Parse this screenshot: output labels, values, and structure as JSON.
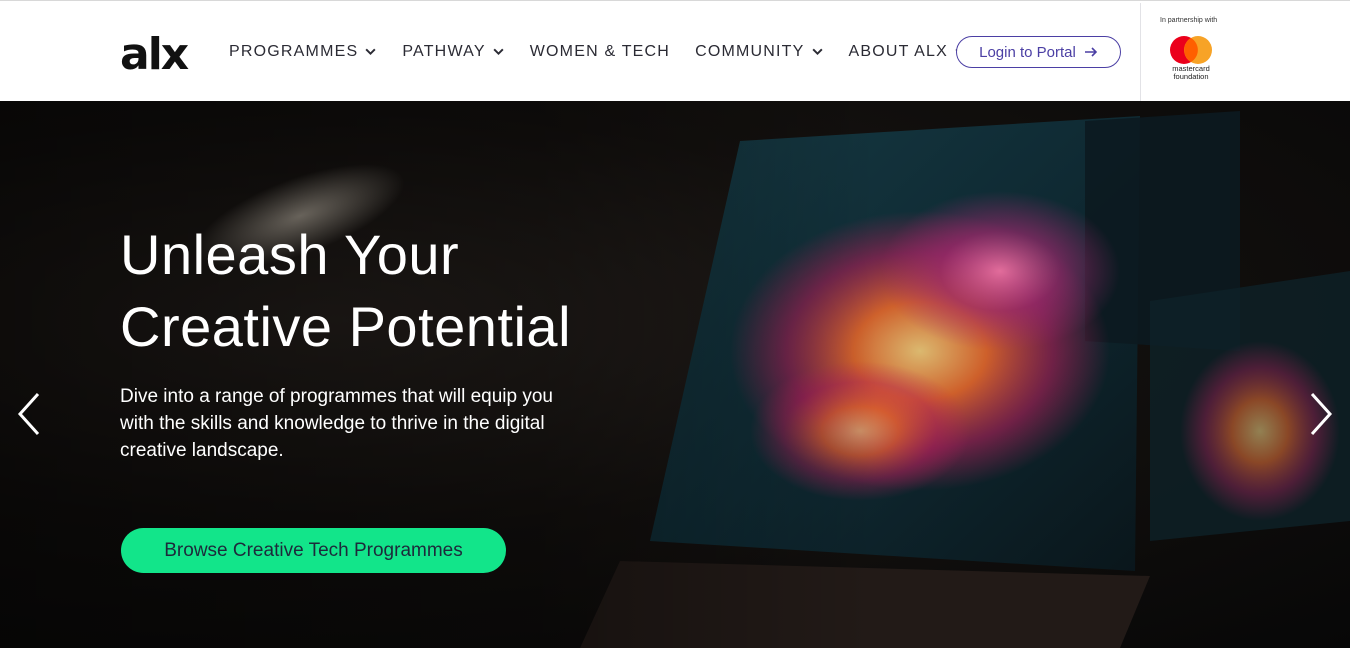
{
  "header": {
    "logo_text": "alx",
    "nav": [
      {
        "label": "PROGRAMMES",
        "dropdown": true
      },
      {
        "label": "PATHWAY",
        "dropdown": true
      },
      {
        "label": "WOMEN & TECH",
        "dropdown": false
      },
      {
        "label": "COMMUNITY",
        "dropdown": true
      },
      {
        "label": "ABOUT ALX",
        "dropdown": true
      }
    ],
    "login_label": "Login to Portal",
    "partner_text": "In partnership with",
    "partner_name_line1": "mastercard",
    "partner_name_line2": "foundation"
  },
  "hero": {
    "title_line1": "Unleash Your",
    "title_line2": "Creative Potential",
    "description": "Dive into a range of programmes that will equip you with the skills and knowledge to thrive in the digital creative landscape.",
    "cta_label": "Browse Creative Tech Programmes"
  },
  "colors": {
    "accent": "#4b3fa4",
    "cta": "#12e58a",
    "mastercard_red": "#eb001b",
    "mastercard_orange": "#f79e1b"
  },
  "icons": [
    "chevron-down-icon",
    "arrow-right-icon",
    "chevron-left-icon",
    "chevron-right-icon",
    "mastercard-logo"
  ]
}
